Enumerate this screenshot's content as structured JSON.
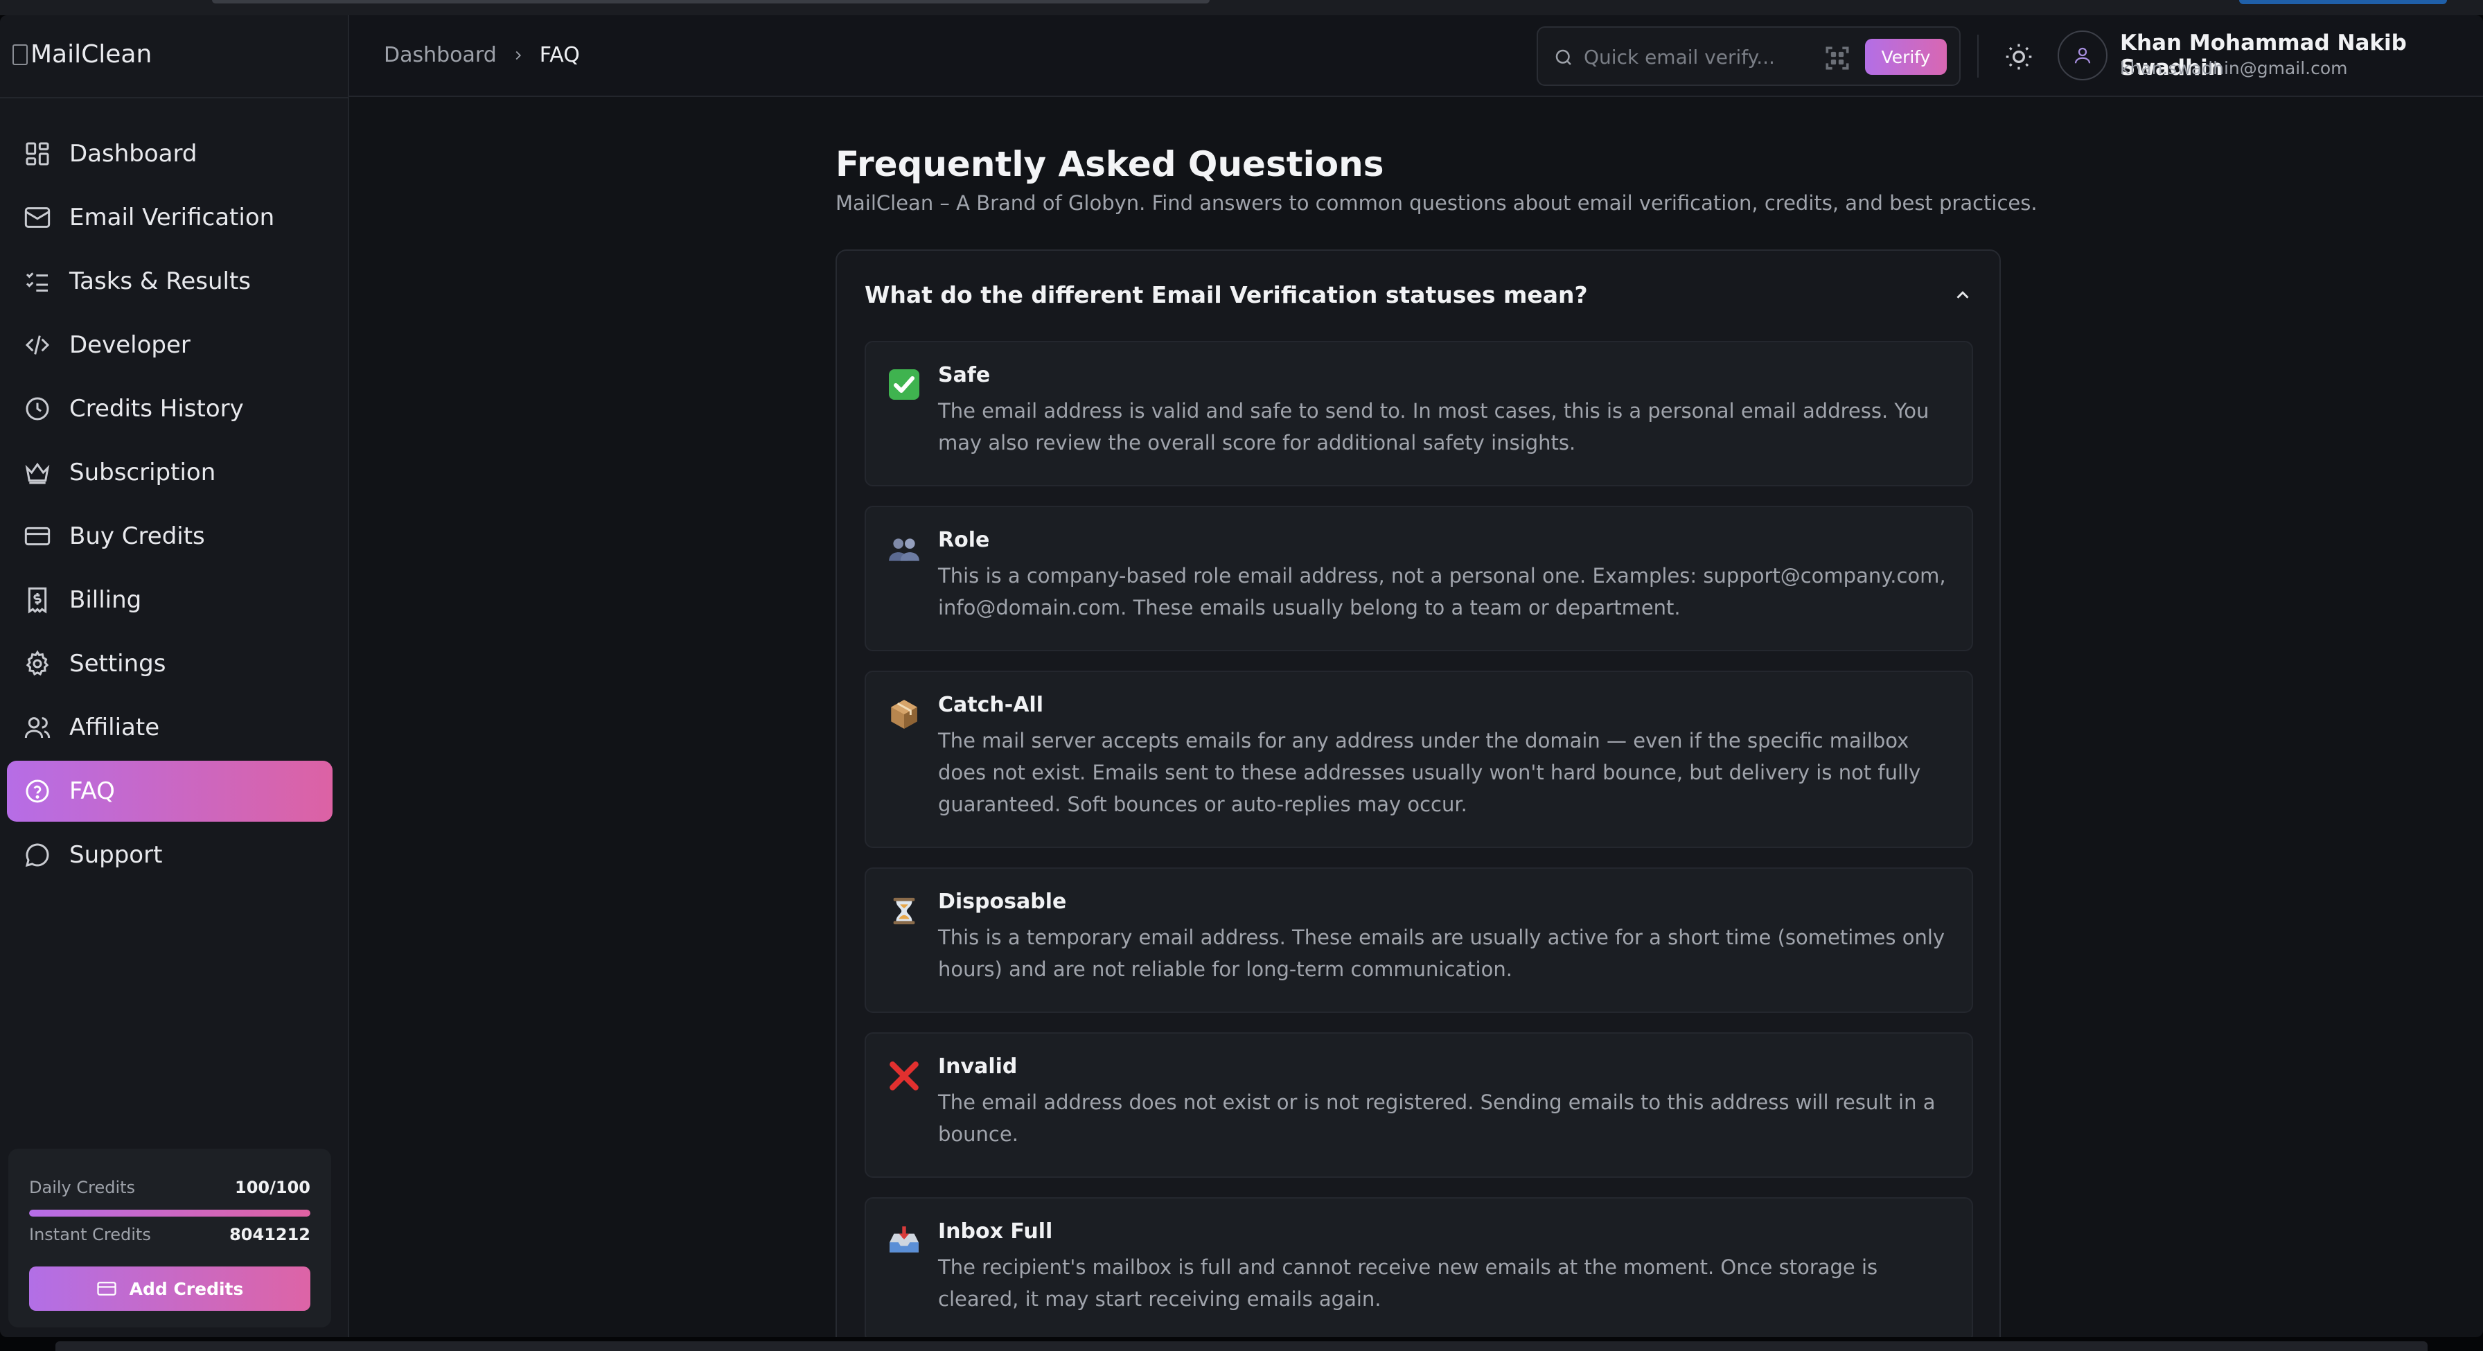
{
  "app": {
    "logo_text": "MailClean"
  },
  "sidebar": {
    "items": [
      {
        "label": "Dashboard",
        "icon": "dashboard-icon"
      },
      {
        "label": "Email Verification",
        "icon": "mail-icon"
      },
      {
        "label": "Tasks & Results",
        "icon": "list-checks-icon"
      },
      {
        "label": "Developer",
        "icon": "code-icon"
      },
      {
        "label": "Credits History",
        "icon": "clock-icon"
      },
      {
        "label": "Subscription",
        "icon": "crown-icon"
      },
      {
        "label": "Buy Credits",
        "icon": "credit-card-icon"
      },
      {
        "label": "Billing",
        "icon": "receipt-icon"
      },
      {
        "label": "Settings",
        "icon": "gear-icon"
      },
      {
        "label": "Affiliate",
        "icon": "users-icon"
      },
      {
        "label": "FAQ",
        "icon": "help-circle-icon",
        "active": true
      },
      {
        "label": "Support",
        "icon": "message-circle-icon"
      }
    ],
    "credits": {
      "daily_label": "Daily Credits",
      "daily_value": "100/100",
      "daily_fraction": 1.0,
      "instant_label": "Instant Credits",
      "instant_value": "8041212",
      "add_button": "Add Credits"
    }
  },
  "header": {
    "breadcrumb": [
      "Dashboard",
      "FAQ"
    ],
    "quick_verify_placeholder": "Quick email verify...",
    "verify_button": "Verify",
    "user_name": "Khan Mohammad Nakib Swadhin",
    "user_email": "khan.swadhin@gmail.com"
  },
  "main": {
    "title": "Frequently Asked Questions",
    "subtitle": "MailClean – A Brand of Globyn. Find answers to common questions about email verification, credits, and best practices.",
    "faq": {
      "question": "What do the different Email Verification statuses mean?",
      "expanded": true,
      "statuses": [
        {
          "name": "Safe",
          "emoji": "check-mark-icon",
          "description": "The email address is valid and safe to send to. In most cases, this is a personal email address. You may also review the overall score for additional safety insights."
        },
        {
          "name": "Role",
          "emoji": "people-icon",
          "description": "This is a company-based role email address, not a personal one. Examples: support@company.com, info@domain.com. These emails usually belong to a team or department."
        },
        {
          "name": "Catch-All",
          "emoji": "package-icon",
          "description": "The mail server accepts emails for any address under the domain — even if the specific mailbox does not exist. Emails sent to these addresses usually won't hard bounce, but delivery is not fully guaranteed. Soft bounces or auto-replies may occur."
        },
        {
          "name": "Disposable",
          "emoji": "hourglass-icon",
          "description": "This is a temporary email address. These emails are usually active for a short time (sometimes only hours) and are not reliable for long-term communication."
        },
        {
          "name": "Invalid",
          "emoji": "cross-mark-icon",
          "description": "The email address does not exist or is not registered. Sending emails to this address will result in a bounce."
        },
        {
          "name": "Inbox Full",
          "emoji": "inbox-tray-icon",
          "description": "The recipient's mailbox is full and cannot receive new emails at the moment. Once storage is cleared, it may start receiving emails again."
        }
      ]
    }
  },
  "colors": {
    "accent_start": "#b66de6",
    "accent_end": "#dc62a4",
    "background": "#111317",
    "sidebar": "#16181d"
  }
}
